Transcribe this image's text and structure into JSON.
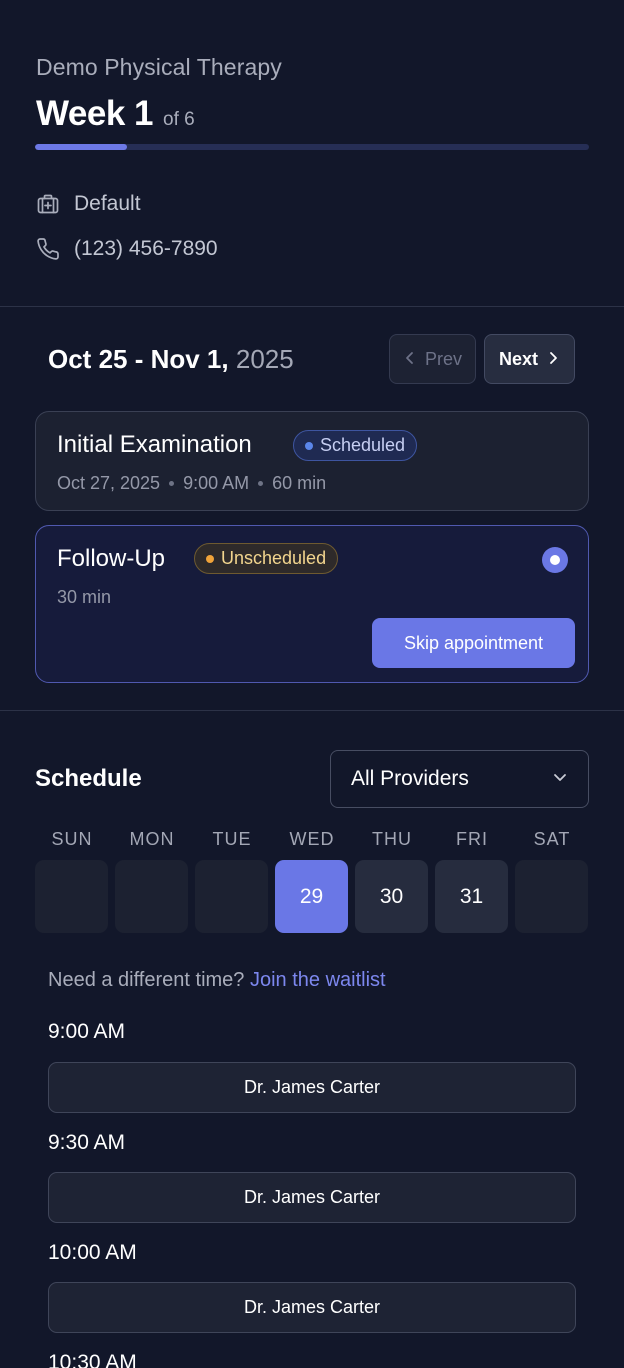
{
  "header": {
    "clinic_name": "Demo Physical Therapy",
    "week_title": "Week 1",
    "week_of": "of 6",
    "progress_fraction": 0.1667,
    "location_icon": "medical-bag-icon",
    "location": "Default",
    "phone_icon": "phone-icon",
    "phone": "(123) 456-7890"
  },
  "week_nav": {
    "range_bold": "Oct 25 - Nov 1,",
    "range_year": "2025",
    "prev_label": "Prev",
    "next_label": "Next"
  },
  "appointments": [
    {
      "title": "Initial Examination",
      "status": "Scheduled",
      "date": "Oct 27, 2025",
      "time": "9:00 AM",
      "duration": "60 min"
    },
    {
      "title": "Follow-Up",
      "status": "Unscheduled",
      "duration": "30 min",
      "action_label": "Skip appointment"
    }
  ],
  "schedule": {
    "title": "Schedule",
    "provider_select": "All Providers",
    "days": [
      {
        "name": "SUN",
        "date": ""
      },
      {
        "name": "MON",
        "date": ""
      },
      {
        "name": "TUE",
        "date": ""
      },
      {
        "name": "WED",
        "date": "29"
      },
      {
        "name": "THU",
        "date": "30"
      },
      {
        "name": "FRI",
        "date": "31"
      },
      {
        "name": "SAT",
        "date": ""
      }
    ],
    "selected_day": "29",
    "waitlist_prompt": "Need a different time?",
    "waitlist_link": "Join the waitlist",
    "slots": [
      {
        "time": "9:00 AM",
        "provider": "Dr. James Carter"
      },
      {
        "time": "9:30 AM",
        "provider": "Dr. James Carter"
      },
      {
        "time": "10:00 AM",
        "provider": "Dr. James Carter"
      },
      {
        "time": "10:30 AM",
        "provider": ""
      }
    ]
  },
  "colors": {
    "background": "#12172a",
    "accent": "#6a77e6",
    "scheduled_dot": "#5b86ea",
    "unscheduled_dot": "#f0a33a"
  }
}
